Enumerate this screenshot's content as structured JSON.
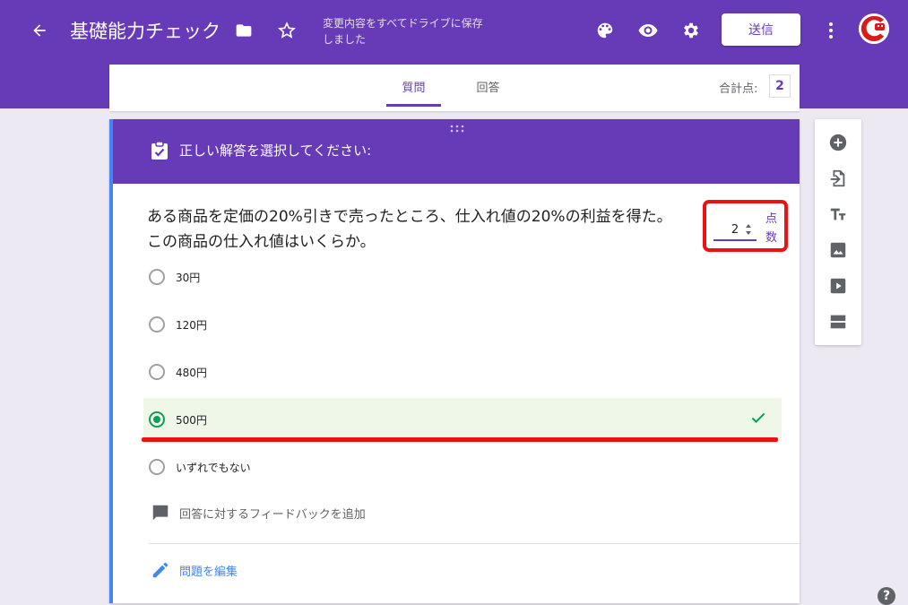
{
  "header": {
    "title": "基礎能力チェック",
    "save_status": "変更内容をすべてドライブに保存しました",
    "send_label": "送信",
    "icons": [
      "back-arrow-icon",
      "folder-icon",
      "star-icon",
      "palette-icon",
      "preview-eye-icon",
      "settings-gear-icon",
      "more-vert-icon"
    ]
  },
  "tabs": [
    {
      "label": "質問",
      "active": true
    },
    {
      "label": "回答",
      "active": false
    }
  ],
  "score": {
    "label": "合計点:",
    "value": "2"
  },
  "question": {
    "header_text": "正しい解答を選択してください:",
    "text": "ある商品を定価の20%引きで売ったところ、仕入れ値の20%の利益を得た。この商品の仕入れ値はいくらか。",
    "points_value": "2",
    "points_label": "点数",
    "options": [
      {
        "label": "30円",
        "checked": false,
        "correct": false
      },
      {
        "label": "120円",
        "checked": false,
        "correct": false
      },
      {
        "label": "480円",
        "checked": false,
        "correct": false
      },
      {
        "label": "500円",
        "checked": true,
        "correct": true
      },
      {
        "label": "いずれでもない",
        "checked": false,
        "correct": false
      }
    ],
    "feedback_label": "回答に対するフィードバックを追加",
    "edit_label": "問題を編集"
  },
  "side_toolbar": [
    "add-question-icon",
    "import-question-icon",
    "add-title-icon",
    "add-image-icon",
    "add-video-icon",
    "add-section-icon"
  ],
  "help_label": "?",
  "colors": {
    "accent": "#673ab7",
    "correct": "#0f9d58",
    "highlight": "#ee1111",
    "link": "#4285f4"
  }
}
